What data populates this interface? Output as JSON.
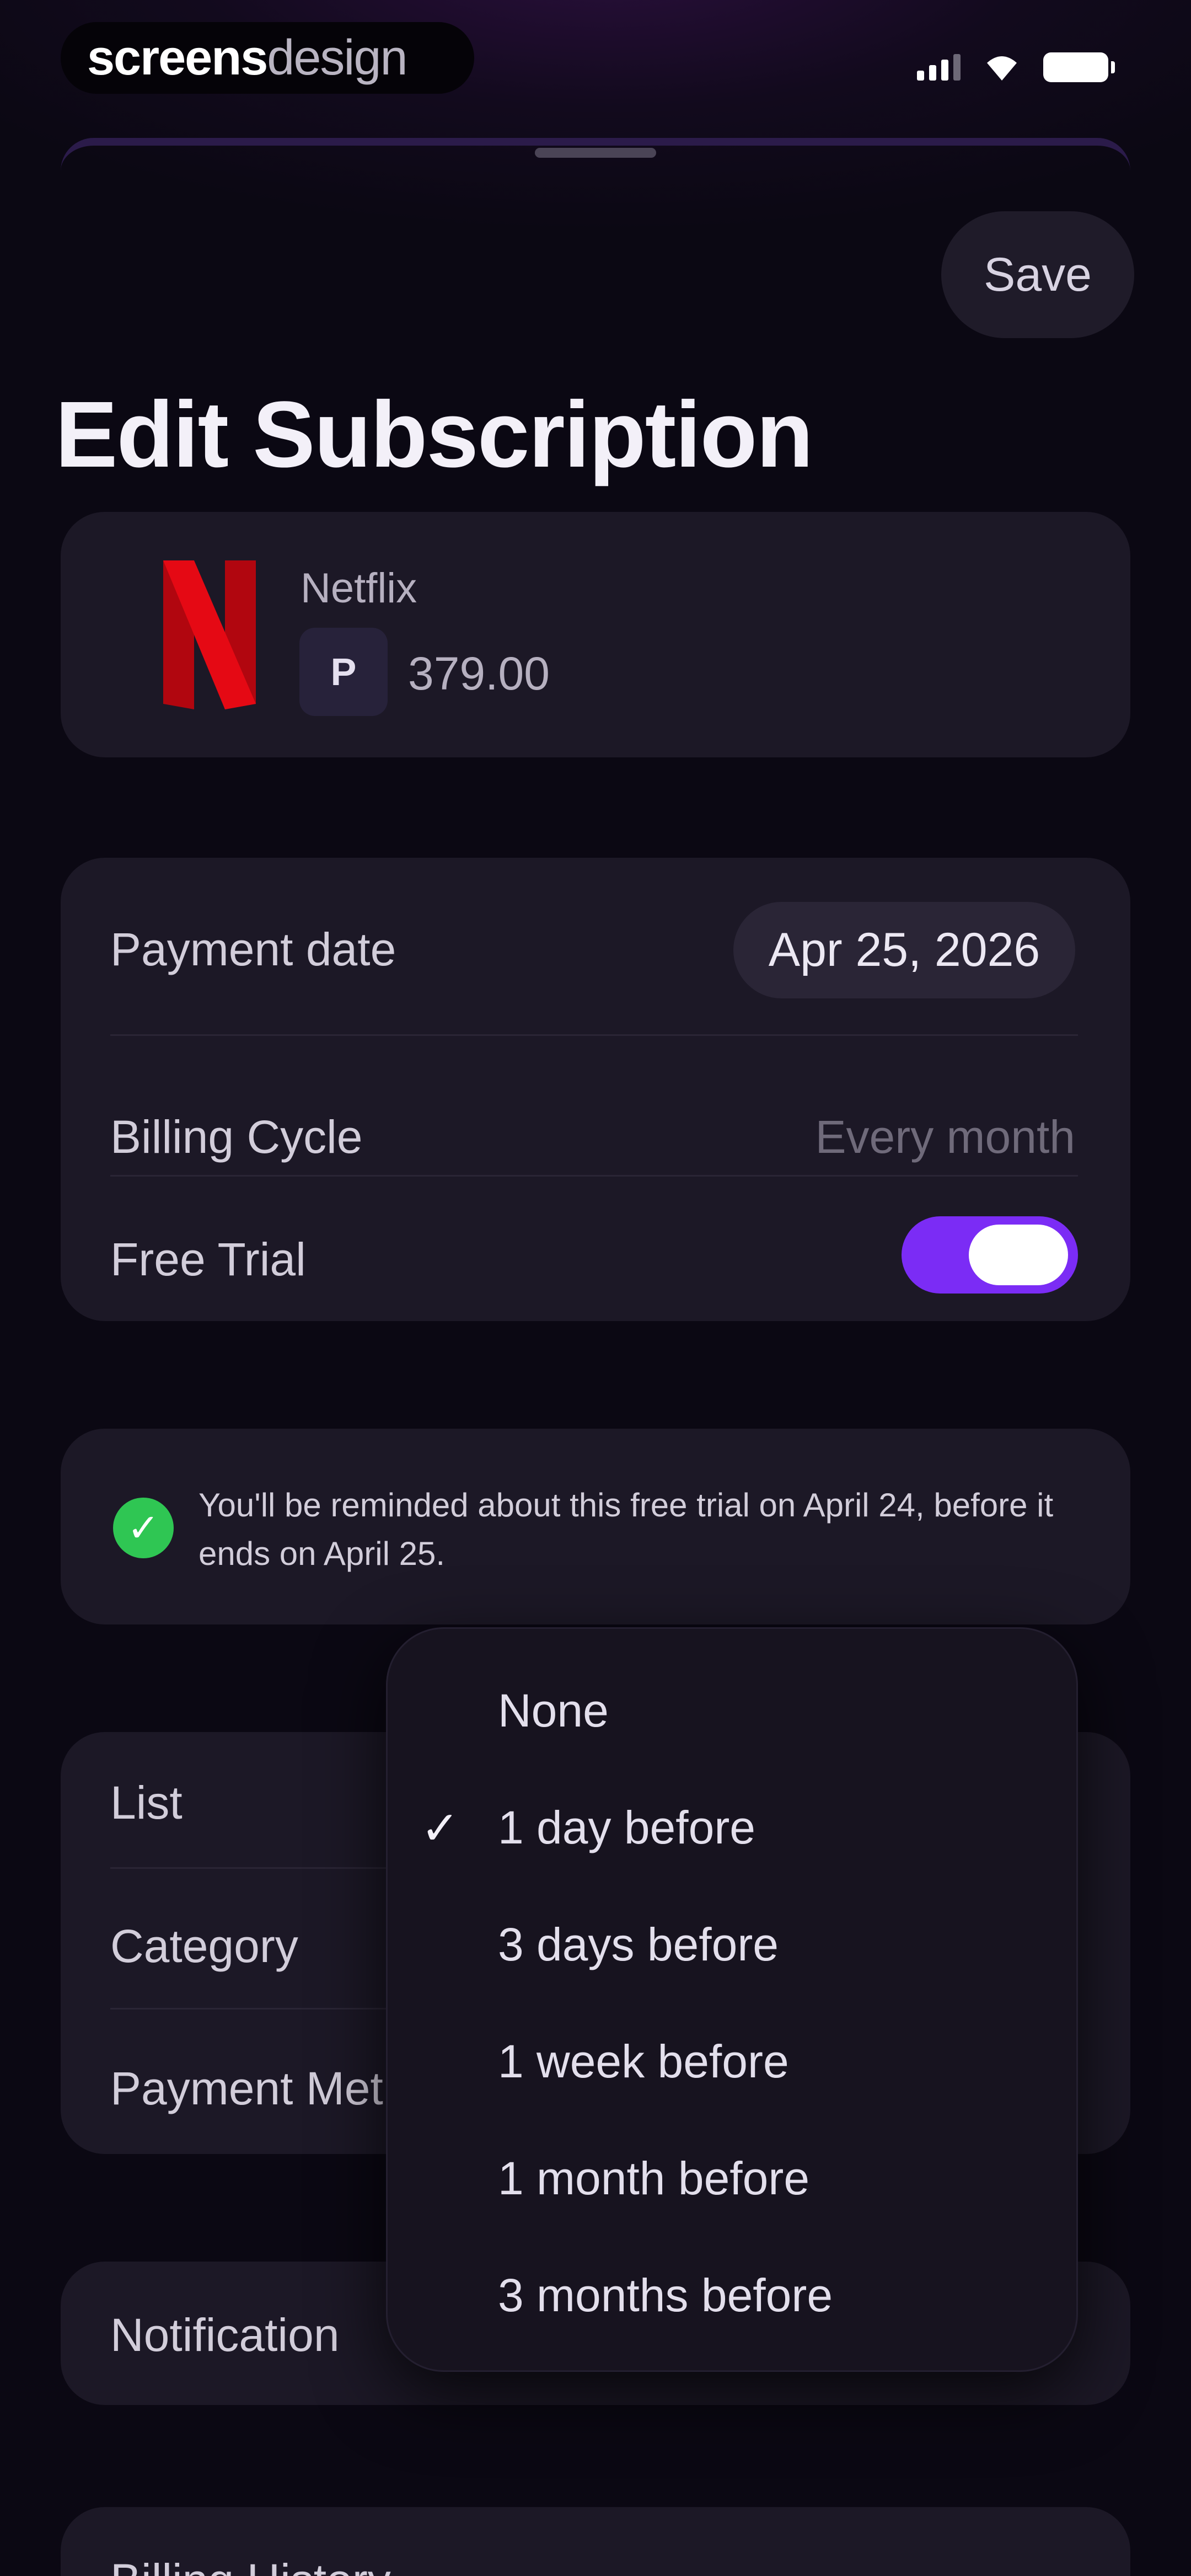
{
  "watermark": {
    "part1": "screens",
    "part2": "design"
  },
  "header": {
    "save_label": "Save",
    "title": "Edit Subscription"
  },
  "service": {
    "name": "Netflix",
    "currency_symbol": "P",
    "price": "379.00",
    "brand_color": "#e50914"
  },
  "details": {
    "payment_date_label": "Payment date",
    "payment_date_value": "Apr 25, 2026",
    "billing_cycle_label": "Billing Cycle",
    "billing_cycle_value": "Every month",
    "free_trial_label": "Free Trial",
    "free_trial_on": true,
    "toggle_color": "#7b2cf5"
  },
  "reminder": {
    "text": "You'll be reminded about this free trial on April 24, before it ends on April 25.",
    "icon": "check-circle-icon",
    "icon_color": "#2fc653"
  },
  "organize": {
    "list_label": "List",
    "category_label": "Category",
    "payment_method_label": "Payment Method"
  },
  "notification": {
    "label": "Notification"
  },
  "billing_history": {
    "label": "Billing History"
  },
  "dropdown": {
    "options": [
      "None",
      "1 day before",
      "3 days before",
      "1 week before",
      "1 month before",
      "3 months before"
    ],
    "selected": "1 day before"
  }
}
